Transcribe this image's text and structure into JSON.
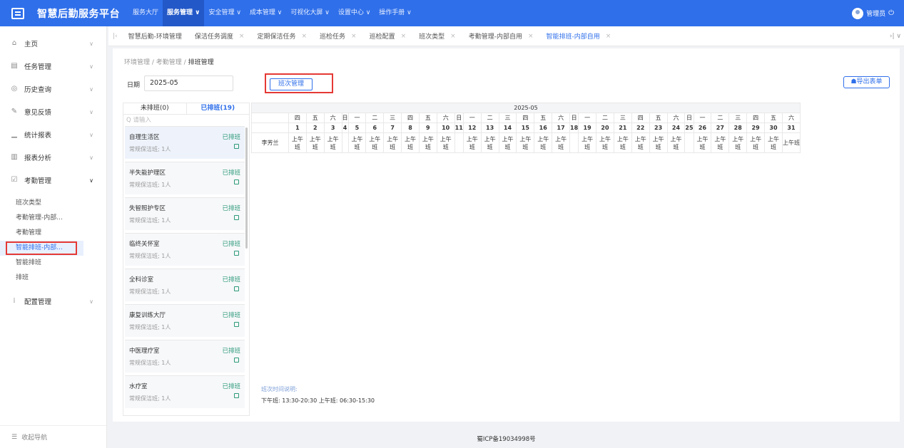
{
  "app": {
    "title": "智慧后勤服务平台"
  },
  "topnav": [
    {
      "label": "服务大厅",
      "active": false
    },
    {
      "label": "服务管理 ∨",
      "active": true
    },
    {
      "label": "安全管理 ∨",
      "active": false
    },
    {
      "label": "成本管理 ∨",
      "active": false
    },
    {
      "label": "可视化大屏 ∨",
      "active": false
    },
    {
      "label": "设置中心 ∨",
      "active": false
    },
    {
      "label": "操作手册 ∨",
      "active": false
    }
  ],
  "user": {
    "name": "管理员"
  },
  "sidebar": {
    "items": [
      {
        "label": "主页",
        "icon": "home-icon"
      },
      {
        "label": "任务管理",
        "icon": "task-icon"
      },
      {
        "label": "历史查询",
        "icon": "history-icon"
      },
      {
        "label": "意见反馈",
        "icon": "feedback-icon"
      },
      {
        "label": "统计报表",
        "icon": "chart-icon"
      },
      {
        "label": "报表分析",
        "icon": "analysis-icon"
      },
      {
        "label": "考勤管理",
        "icon": "attendance-icon"
      }
    ],
    "sub": [
      "班次类型",
      "考勤管理-内部...",
      "考勤管理",
      "智能排班-内部...",
      "智能排班",
      "排班"
    ],
    "config": {
      "label": "配置管理",
      "icon": "config-icon"
    },
    "collapse": "收起导航"
  },
  "tabs": [
    {
      "label": "智慧后勤-环境管理",
      "closable": false
    },
    {
      "label": "保洁任务调度",
      "closable": true
    },
    {
      "label": "定期保洁任务",
      "closable": true
    },
    {
      "label": "巡检任务",
      "closable": true
    },
    {
      "label": "巡检配置",
      "closable": true
    },
    {
      "label": "班次类型",
      "closable": true
    },
    {
      "label": "考勤管理-内部自用",
      "closable": true
    },
    {
      "label": "智能排班-内部自用",
      "closable": true,
      "active": true
    }
  ],
  "breadcrumb": [
    "环境管理",
    "考勤管理",
    "排班管理"
  ],
  "filter": {
    "date_label": "日期",
    "date_value": "2025-05"
  },
  "buttons": {
    "shift": "班次管理",
    "export": "导出表单"
  },
  "panel": {
    "tab_unscheduled": "未排班(0)",
    "tab_scheduled": "已排班(19)",
    "search_placeholder": "请输入",
    "areas": [
      {
        "name": "自理生活区",
        "status": "已排班",
        "desc": "常规保洁班; 1人"
      },
      {
        "name": "半失能护理区",
        "status": "已排班",
        "desc": "常规保洁班; 1人"
      },
      {
        "name": "失智照护专区",
        "status": "已排班",
        "desc": "常规保洁班; 1人"
      },
      {
        "name": "临终关怀室",
        "status": "已排班",
        "desc": "常规保洁班; 1人"
      },
      {
        "name": "全科诊室",
        "status": "已排班",
        "desc": "常规保洁班; 1人"
      },
      {
        "name": "康复训练大厅",
        "status": "已排班",
        "desc": "常规保洁班; 1人"
      },
      {
        "name": "中医理疗室",
        "status": "已排班",
        "desc": "常规保洁班; 1人"
      },
      {
        "name": "水疗室",
        "status": "已排班",
        "desc": "常规保洁班; 1人"
      }
    ]
  },
  "schedule": {
    "month": "2025-05",
    "weekdays": [
      "四",
      "五",
      "六",
      "日",
      "一",
      "二",
      "三",
      "四",
      "五",
      "六",
      "日",
      "一",
      "二",
      "三",
      "四",
      "五",
      "六",
      "日",
      "一",
      "二",
      "三",
      "四",
      "五",
      "六",
      "日",
      "一",
      "二",
      "三",
      "四",
      "五",
      "六"
    ],
    "days": [
      "1",
      "2",
      "3",
      "4",
      "5",
      "6",
      "7",
      "8",
      "9",
      "10",
      "11",
      "12",
      "13",
      "14",
      "15",
      "16",
      "17",
      "18",
      "19",
      "20",
      "21",
      "22",
      "23",
      "24",
      "25",
      "26",
      "27",
      "28",
      "29",
      "30",
      "31"
    ],
    "person": "李芳兰",
    "shifts": [
      "上午班",
      "上午班",
      "上午班",
      "",
      "上午班",
      "上午班",
      "上午班",
      "上午班",
      "上午班",
      "上午班",
      "",
      "上午班",
      "上午班",
      "上午班",
      "上午班",
      "上午班",
      "上午班",
      "",
      "上午班",
      "上午班",
      "上午班",
      "上午班",
      "上午班",
      "上午班",
      "",
      "上午班",
      "上午班",
      "上午班",
      "上午班",
      "上午班",
      "上午班"
    ]
  },
  "legend": {
    "title": "班次时间说明:",
    "text": "下午班: 13:30-20:30    上午班: 06:30-15:30"
  },
  "footer": "蜀ICP备19034998号"
}
